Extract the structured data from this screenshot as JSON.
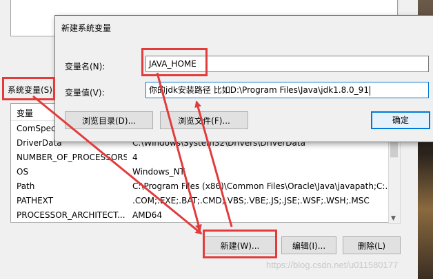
{
  "dialog": {
    "title": "新建系统变量",
    "name_label": "变量名(N):",
    "name_value": "JAVA_HOME",
    "value_label": "变量值(V):",
    "value_value": "你的jdk安装路径 比如D:\\Program Files\\Java\\jdk1.8.0_91",
    "browse_dir": "浏览目录(D)...",
    "browse_file": "浏览文件(F)...",
    "ok": "确定"
  },
  "system_vars": {
    "label": "系统变量(S)",
    "column_header": "变量",
    "rows": [
      {
        "name": "ComSpec",
        "value": ""
      },
      {
        "name": "DriverData",
        "value": "C:\\Windows\\System32\\Drivers\\DriverData"
      },
      {
        "name": "NUMBER_OF_PROCESSORS",
        "value": "4"
      },
      {
        "name": "OS",
        "value": "Windows_NT"
      },
      {
        "name": "Path",
        "value": "C:\\Program Files (x86)\\Common Files\\Oracle\\Java\\javapath;C:..."
      },
      {
        "name": "PATHEXT",
        "value": ".COM;.EXE;.BAT;.CMD;.VBS;.VBE;.JS;.JSE;.WSF;.WSH;.MSC"
      },
      {
        "name": "PROCESSOR_ARCHITECT...",
        "value": "AMD64"
      }
    ],
    "buttons": {
      "new": "新建(W)...",
      "edit": "编辑(I)...",
      "delete": "删除(L)"
    }
  },
  "watermark": "https://blog.csdn.net/u011580177",
  "colors": {
    "annotation": "#e23b3b",
    "focus": "#0078d7"
  }
}
